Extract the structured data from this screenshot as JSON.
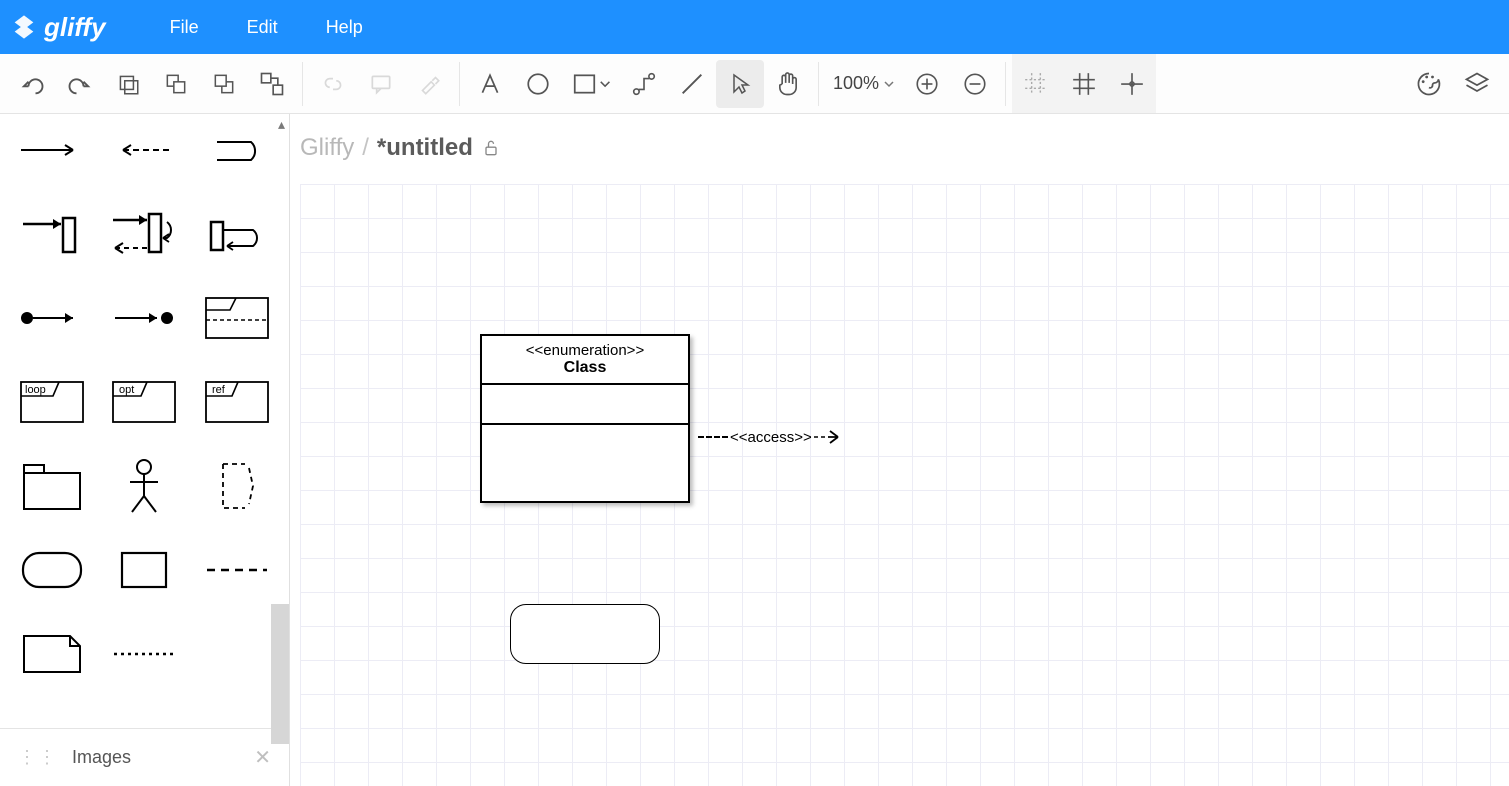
{
  "menubar": {
    "brand": "gliffy",
    "items": [
      "File",
      "Edit",
      "Help"
    ]
  },
  "toolbar": {
    "zoom": "100%"
  },
  "breadcrumb": {
    "root": "Gliffy",
    "sep": "/",
    "title": "*untitled"
  },
  "sidebar": {
    "frames": {
      "loop": "loop",
      "opt": "opt",
      "ref": "ref"
    },
    "images_label": "Images"
  },
  "canvas": {
    "uml_class": {
      "stereotype": "<<enumeration>>",
      "name": "Class"
    },
    "access_label": "<<access>>"
  }
}
